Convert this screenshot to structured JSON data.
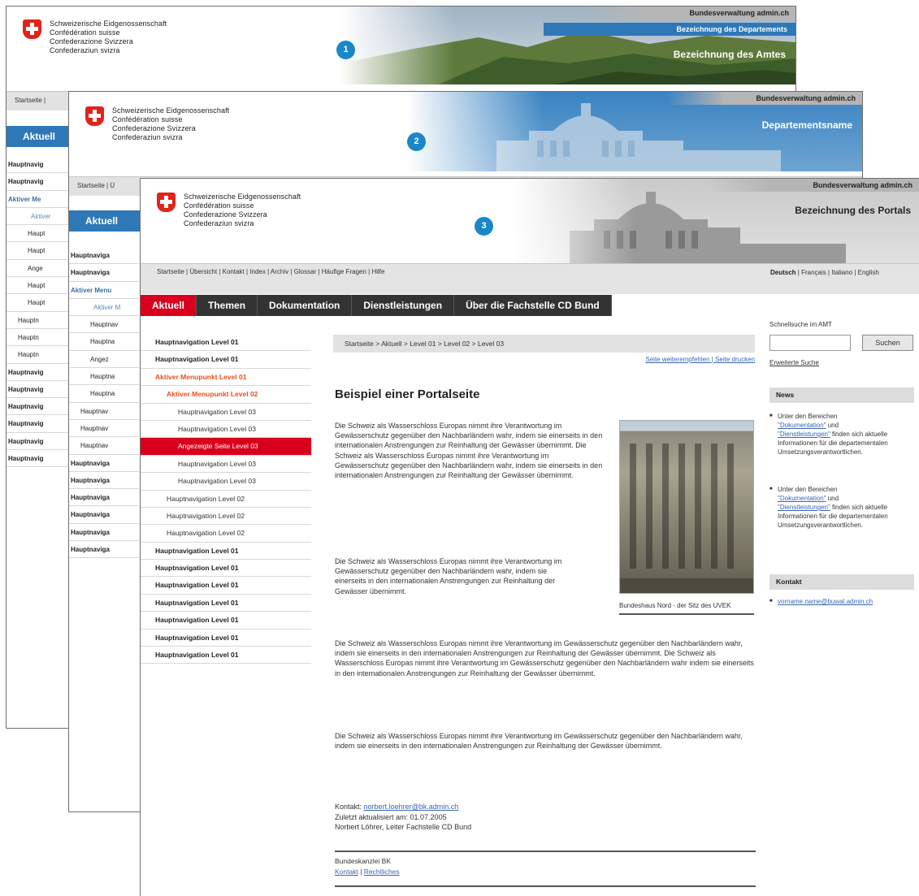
{
  "header": {
    "brand_lines": [
      "Schweizerische Eidgenossenschaft",
      "Confédération suisse",
      "Confederazione Svizzera",
      "Confederaziun svizra"
    ]
  },
  "sheet1": {
    "badge": "1",
    "top_bar": "Bundesverwaltung admin.ch",
    "dept_bar": "Bezeichnung des Departements",
    "banner_title": "Bezeichnung des Amtes",
    "service_stub": "Startseite |",
    "nav_stub": "Aktuell",
    "nav_items": [
      {
        "label": "Hauptnavig",
        "level": "l1"
      },
      {
        "label": "Hauptnavig",
        "level": "l1"
      },
      {
        "label": "Aktiver Me",
        "level": "l1 act"
      },
      {
        "label": "Aktiver",
        "level": "l2 act2"
      },
      {
        "label": "Haupt",
        "level": "l3"
      },
      {
        "label": "Haupt",
        "level": "l3"
      },
      {
        "label": "Ange",
        "level": "l3"
      },
      {
        "label": "Haupt",
        "level": "l3"
      },
      {
        "label": "Haupt",
        "level": "l3"
      },
      {
        "label": "Hauptn",
        "level": "l2"
      },
      {
        "label": "Hauptn",
        "level": "l2"
      },
      {
        "label": "Hauptn",
        "level": "l2"
      },
      {
        "label": "Hauptnavig",
        "level": "l1"
      },
      {
        "label": "Hauptnavig",
        "level": "l1"
      },
      {
        "label": "Hauptnavig",
        "level": "l1"
      },
      {
        "label": "Hauptnavig",
        "level": "l1"
      },
      {
        "label": "Hauptnavig",
        "level": "l1"
      },
      {
        "label": "Hauptnavig",
        "level": "l1"
      }
    ]
  },
  "sheet2": {
    "badge": "2",
    "top_bar": "Bundesverwaltung admin.ch",
    "banner_title": "Departementsname",
    "service_stub": "Startseite | Ü",
    "nav_stub": "Aktuell",
    "nav_items": [
      {
        "label": "Hauptnaviga",
        "level": "l1"
      },
      {
        "label": "Hauptnaviga",
        "level": "l1"
      },
      {
        "label": "Aktiver Menu",
        "level": "l1 act"
      },
      {
        "label": "Aktiver M",
        "level": "l2 act2"
      },
      {
        "label": "Hauptnav",
        "level": "l3"
      },
      {
        "label": "Hauptna",
        "level": "l3"
      },
      {
        "label": "Angez",
        "level": "l3"
      },
      {
        "label": "Hauptna",
        "level": "l3"
      },
      {
        "label": "Hauptna",
        "level": "l3"
      },
      {
        "label": "Hauptnav",
        "level": "l2"
      },
      {
        "label": "Hauptnav",
        "level": "l2"
      },
      {
        "label": "Hauptnav",
        "level": "l2"
      },
      {
        "label": "Hauptnaviga",
        "level": "l1"
      },
      {
        "label": "Hauptnaviga",
        "level": "l1"
      },
      {
        "label": "Hauptnaviga",
        "level": "l1"
      },
      {
        "label": "Hauptnaviga",
        "level": "l1"
      },
      {
        "label": "Hauptnaviga",
        "level": "l1"
      },
      {
        "label": "Hauptnaviga",
        "level": "l1"
      }
    ]
  },
  "sheet3": {
    "badge": "3",
    "top_bar": "Bundesverwaltung admin.ch",
    "banner_title": "Bezeichnung des Portals",
    "service_links": "Startseite | Übersicht | Kontakt | Index | Archiv | Glossar | Häufige Fragen | Hilfe",
    "languages": {
      "active": "Deutsch",
      "others": " | Français | Italiano | English"
    },
    "main_nav": [
      "Aktuell",
      "Themen",
      "Dokumentation",
      "Dienstleistungen",
      "Über die Fachstelle CD Bund"
    ],
    "left_nav": [
      {
        "label": "Hauptnavigation Level 01",
        "level": "l1"
      },
      {
        "label": "Hauptnavigation Level 01",
        "level": "l1"
      },
      {
        "label": "Aktiver Menupunkt Level 01",
        "level": "l1 act"
      },
      {
        "label": "Aktiver Menupunkt Level 02",
        "level": "l2 act"
      },
      {
        "label": "Hauptnavigation Level 03",
        "level": "l3"
      },
      {
        "label": "Hauptnavigation Level 03",
        "level": "l3"
      },
      {
        "label": "Angezeigte Seite Level 03",
        "level": "l3 cur"
      },
      {
        "label": "Hauptnavigation Level 03",
        "level": "l3"
      },
      {
        "label": "Hauptnavigation Level 03",
        "level": "l3"
      },
      {
        "label": "Hauptnavigation Level 02",
        "level": "l2"
      },
      {
        "label": "Hauptnavigation Level 02",
        "level": "l2"
      },
      {
        "label": "Hauptnavigation Level 02",
        "level": "l2"
      },
      {
        "label": "Hauptnavigation Level 01",
        "level": "l1"
      },
      {
        "label": "Hauptnavigation Level 01",
        "level": "l1"
      },
      {
        "label": "Hauptnavigation Level 01",
        "level": "l1"
      },
      {
        "label": "Hauptnavigation Level 01",
        "level": "l1"
      },
      {
        "label": "Hauptnavigation Level 01",
        "level": "l1"
      },
      {
        "label": "Hauptnavigation Level 01",
        "level": "l1"
      },
      {
        "label": "Hauptnavigation Level 01",
        "level": "l1"
      }
    ],
    "breadcrumb": "Startseite > Aktuell > Level 01 > Level 02 > Level 03",
    "tools": {
      "recommend": "Seite weiterempfehlen",
      "print": "Seite drucken"
    },
    "page_title": "Beispiel einer Portalseite",
    "paragraphs": [
      "Die Schweiz als Wasserschloss Europas nimmt ihre Verantwortung im Gewässerschutz gegenüber den Nachbarländern wahr, indem sie einerseits in den internationalen Anstrengungen zur Reinhaltung der Gewässer übernimmt. Die Schweiz als Wasserschloss Europas nimmt ihre Verantwortung im Gewässerschutz gegenüber den Nachbarländern wahr, indem sie einerseits in den internationalen Anstrengungen zur Reinhaltung der Gewässer übernimmt.",
      "Die Schweiz als Wasserschloss Europas nimmt ihre Verantwortung im Gewässerschutz gegenüber den Nachbarländern wahr, indem sie einerseits in den internationalen Anstrengungen zur Reinhaltung der Gewässer übernimmt.",
      "Die Schweiz als Wasserschloss Europas nimmt ihre Verantwortung im Gewässerschutz gegenüber den Nachbarländern wahr, indem sie einerseits in den internationalen Anstrengungen zur Reinhaltung der Gewässer übernimmt. Die Schweiz als Wasserschloss Europas nimmt ihre Verantwortung im Gewässerschutz gegenüber den Nachbarländern wahr indem sie einerseits in den internationalen Anstrengungen zur Reinhaltung der Gewässer übernimmt.",
      "Die Schweiz als Wasserschloss Europas nimmt ihre Verantwortung im Gewässerschutz gegenüber den Nachbarländern wahr, indem sie einerseits in den internationalen Anstrengungen zur Reinhaltung der Gewässer übernimmt."
    ],
    "photo_caption": "Bundeshaus Nord - der Sitz des UVEK",
    "contact": {
      "label": "Kontakt:",
      "email": "norbert.loehrer@bk.admin.ch",
      "updated": "Zuletzt aktualisiert am: 01.07.2005",
      "author": "Norbert Löhrer, Leiter Fachstelle CD Bund"
    },
    "footer": {
      "org": "Bundeskanzlei BK",
      "contact_link": "Kontakt",
      "legal_link": "Rechtliches"
    },
    "search": {
      "label": "Schnellsuche im AMT",
      "button": "Suchen",
      "advanced": "Erweiterte Suche"
    },
    "news": {
      "title": "News",
      "items": [
        {
          "prefix": "Unter den Bereichen",
          "link1": "\"Dokumentation\"",
          "mid": " und ",
          "link2": "\"Dienstleistungen\"",
          "suffix": " finden sich aktuelle Informationen für die departementalen Umsetzungsverantwortlichen."
        },
        {
          "prefix": "Unter den Bereichen",
          "link1": "\"Dokumentation\"",
          "mid": " und ",
          "link2": "\"Dienstleistungen\"",
          "suffix": " finden sich aktuelle Informationen für die departementalen Umsetzungsverantwortlichen."
        }
      ]
    },
    "contact_box": {
      "title": "Kontakt",
      "email": "vorname.name@buwal.admin.ch"
    }
  }
}
